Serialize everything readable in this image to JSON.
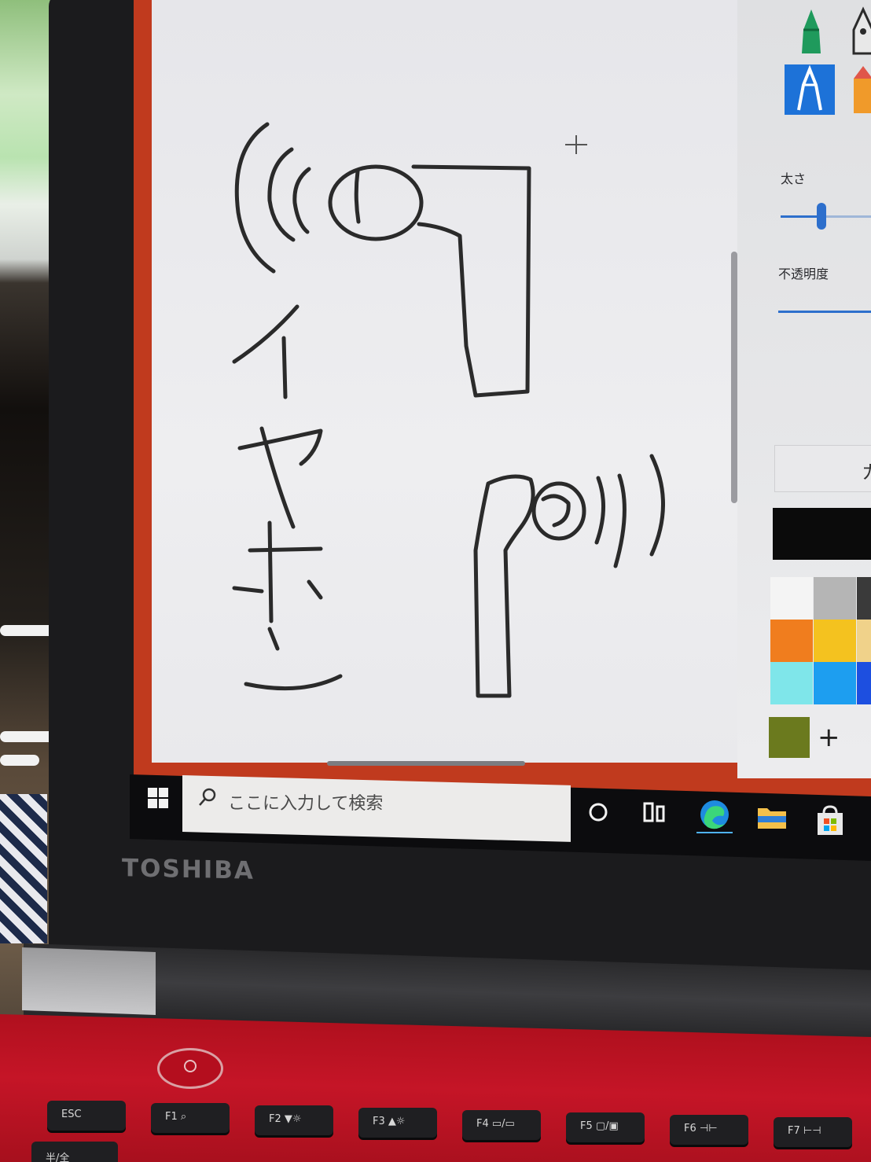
{
  "scene": {
    "description_kind": "photo-of-laptop-screen"
  },
  "paint_app": {
    "panel": {
      "thickness_label": "太さ",
      "opacity_label": "不透明度",
      "thickness_value": 0.4,
      "opacity_value": 1.0,
      "button_fragment": "カ",
      "add_color_symbol": "+",
      "selected_color": "#0b0b0b",
      "palette": [
        "#f4f4f4",
        "#b5b5b5",
        "#3a3a3a",
        "#f07d1e",
        "#f4c21f",
        "#f0d28a",
        "#7fe6ea",
        "#1d9ef0",
        "#1d4fe0",
        "#6b7a1e"
      ],
      "tools": [
        {
          "name": "marker",
          "icon": "marker-icon",
          "color": "#1f9a5c"
        },
        {
          "name": "calligraphy-pen",
          "icon": "calligraphy-pen-icon",
          "color": "#2b2b2b"
        },
        {
          "name": "pencil",
          "icon": "pencil-icon",
          "color": "#ffffff",
          "selected": true
        },
        {
          "name": "crayon",
          "icon": "crayon-icon",
          "color": "#f09a2a"
        }
      ]
    },
    "drawing_text": "イヤホン"
  },
  "taskbar": {
    "search_placeholder": "ここに入力して検索",
    "icons": [
      "windows-start-icon",
      "cortana-circle-icon",
      "task-view-icon",
      "edge-icon",
      "file-explorer-icon",
      "store-icon"
    ]
  },
  "laptop": {
    "brand": "TOSHIBA",
    "keys": [
      {
        "top": "ESC",
        "sub": ""
      },
      {
        "top": "F1",
        "sub": "⌕"
      },
      {
        "top": "F2",
        "sub": "▼☼"
      },
      {
        "top": "F3",
        "sub": "▲☼"
      },
      {
        "top": "F4",
        "sub": "▭/▭"
      },
      {
        "top": "F5",
        "sub": "▢/▣"
      },
      {
        "top": "F6",
        "sub": "⊣⊢"
      },
      {
        "top": "F7",
        "sub": "⊢⊣"
      }
    ],
    "row2_first_key": "半/全"
  }
}
